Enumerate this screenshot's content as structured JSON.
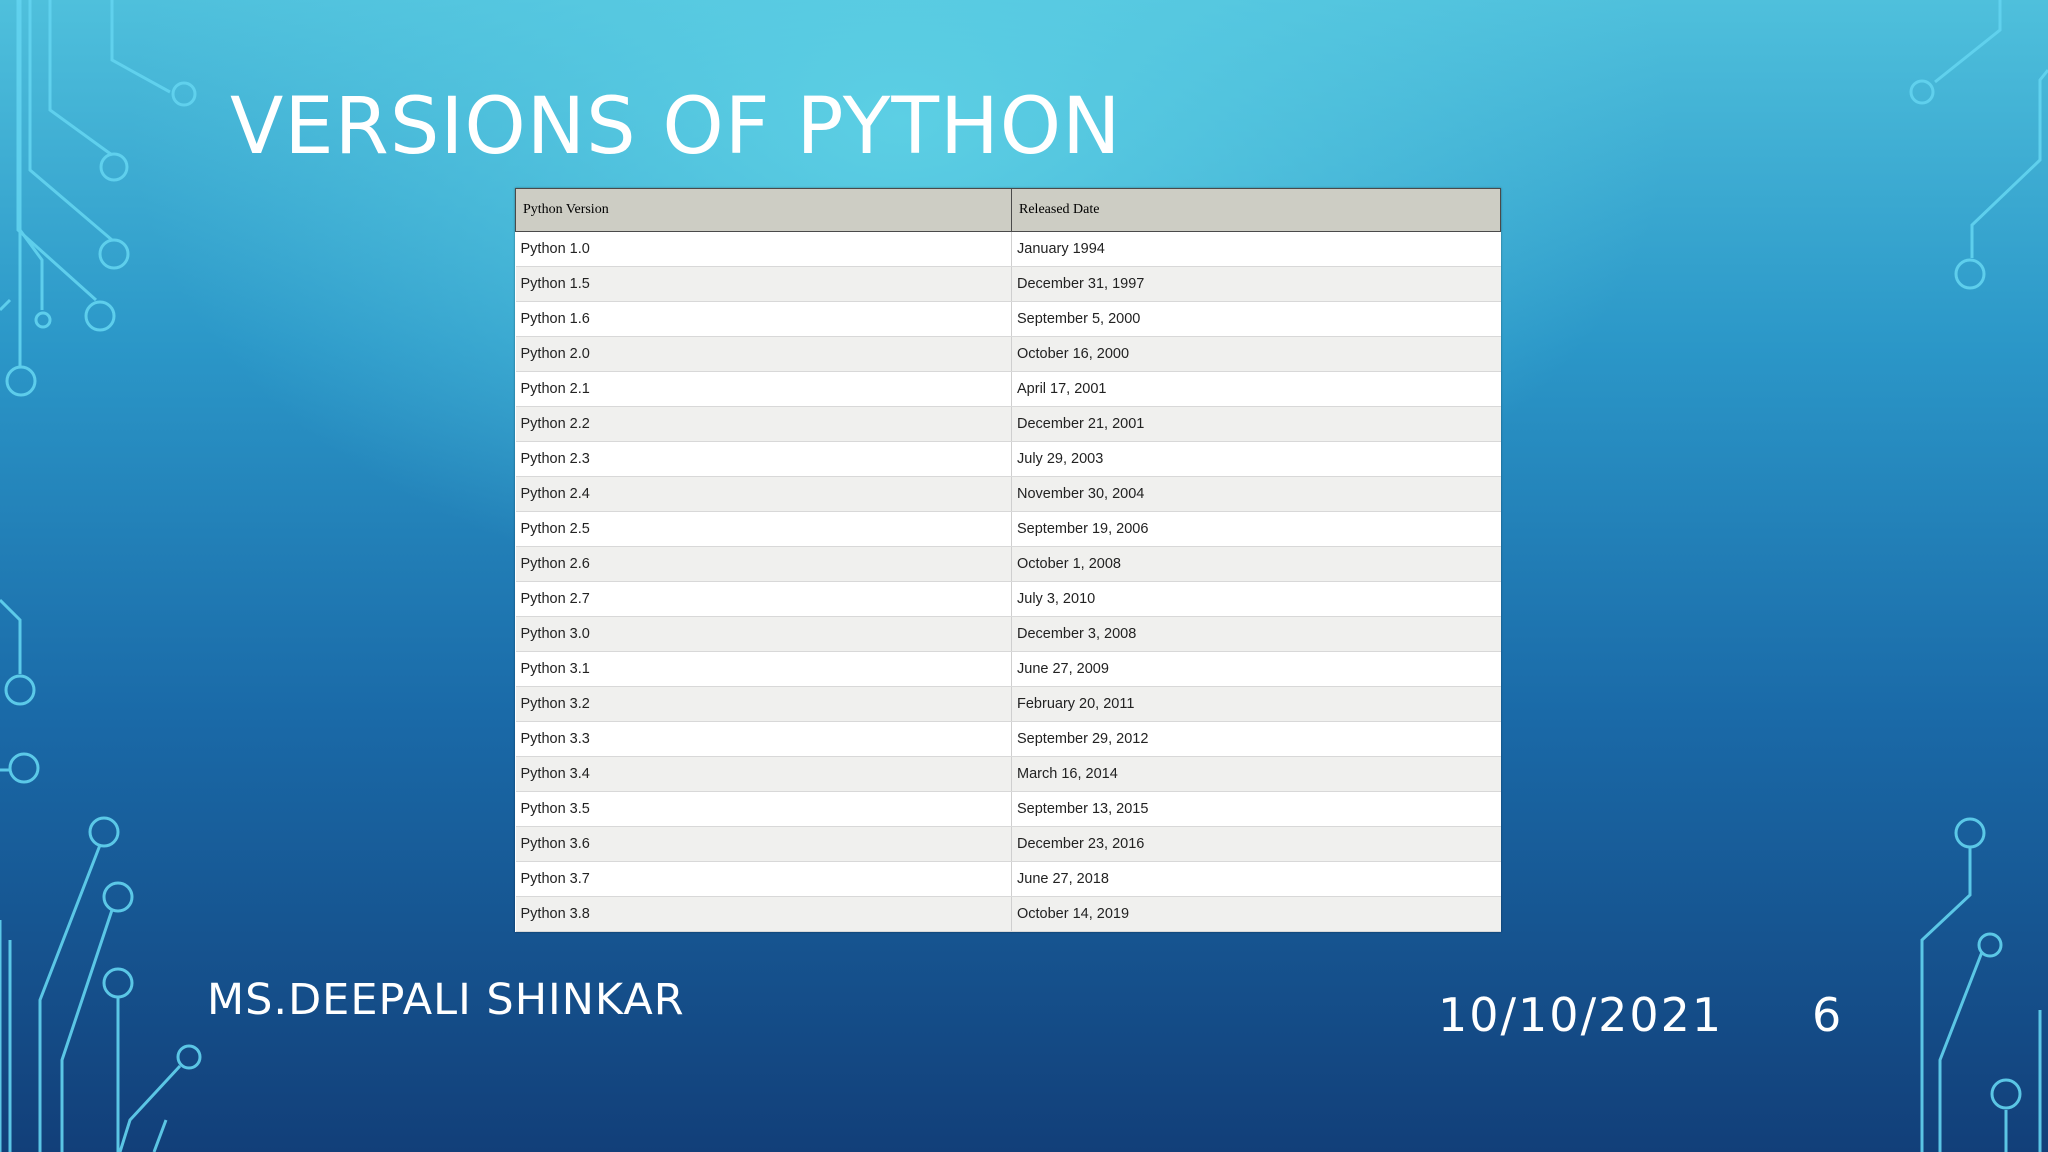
{
  "slide": {
    "title": "VERSIONS OF PYTHON",
    "presenter": "MS.DEEPALI SHINKAR",
    "date": "10/10/2021",
    "page_number": "6"
  },
  "table": {
    "headers": [
      "Python Version",
      "Released Date"
    ],
    "rows": [
      [
        "Python 1.0",
        "January 1994"
      ],
      [
        "Python 1.5",
        "December 31, 1997"
      ],
      [
        "Python 1.6",
        "September 5, 2000"
      ],
      [
        "Python 2.0",
        "October 16, 2000"
      ],
      [
        "Python 2.1",
        "April 17, 2001"
      ],
      [
        "Python 2.2",
        "December 21, 2001"
      ],
      [
        "Python 2.3",
        "July 29, 2003"
      ],
      [
        "Python 2.4",
        "November 30, 2004"
      ],
      [
        "Python 2.5",
        "September 19, 2006"
      ],
      [
        "Python 2.6",
        "October 1, 2008"
      ],
      [
        "Python 2.7",
        "July 3, 2010"
      ],
      [
        "Python 3.0",
        "December 3, 2008"
      ],
      [
        "Python 3.1",
        "June 27, 2009"
      ],
      [
        "Python 3.2",
        "February 20, 2011"
      ],
      [
        "Python 3.3",
        "September 29, 2012"
      ],
      [
        "Python 3.4",
        "March 16, 2014"
      ],
      [
        "Python 3.5",
        "September 13, 2015"
      ],
      [
        "Python 3.6",
        "December 23, 2016"
      ],
      [
        "Python 3.7",
        "June 27, 2018"
      ],
      [
        "Python 3.8",
        "October 14, 2019"
      ]
    ]
  },
  "colors": {
    "background_top": "#4fc0dc",
    "background_bottom": "#123f79",
    "circuit_lines": "#5fd3ef",
    "header_fill": "#cdcdc4"
  }
}
